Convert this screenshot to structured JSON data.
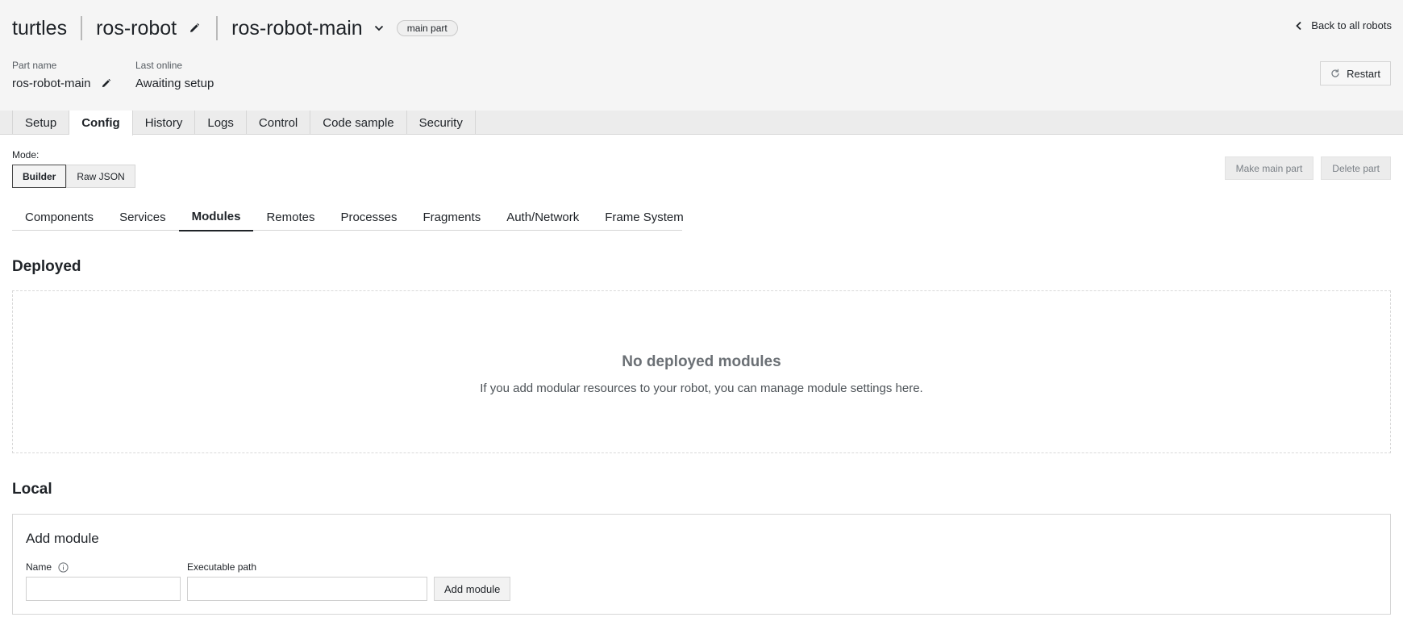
{
  "header": {
    "org": "turtles",
    "robot": "ros-robot",
    "part": "ros-robot-main",
    "badge": "main part",
    "back_label": "Back to all robots"
  },
  "meta": {
    "part_name_label": "Part name",
    "part_name_value": "ros-robot-main",
    "last_online_label": "Last online",
    "last_online_value": "Awaiting setup"
  },
  "restart_label": "Restart",
  "tabs": [
    {
      "label": "Setup"
    },
    {
      "label": "Config",
      "active": true
    },
    {
      "label": "History"
    },
    {
      "label": "Logs"
    },
    {
      "label": "Control"
    },
    {
      "label": "Code sample"
    },
    {
      "label": "Security"
    }
  ],
  "mode": {
    "label": "Mode:",
    "options": [
      "Builder",
      "Raw JSON"
    ],
    "selected": "Builder"
  },
  "part_actions": {
    "make_main": "Make main part",
    "delete": "Delete part"
  },
  "subtabs": [
    {
      "label": "Components"
    },
    {
      "label": "Services"
    },
    {
      "label": "Modules",
      "active": true
    },
    {
      "label": "Remotes"
    },
    {
      "label": "Processes"
    },
    {
      "label": "Fragments"
    },
    {
      "label": "Auth/Network"
    },
    {
      "label": "Frame System"
    }
  ],
  "deployed": {
    "title": "Deployed",
    "empty_title": "No deployed modules",
    "empty_text": "If you add modular resources to your robot, you can manage module settings here."
  },
  "local": {
    "title": "Local",
    "card_title": "Add module",
    "name_label": "Name",
    "name_value": "",
    "path_label": "Executable path",
    "path_value": "",
    "add_button": "Add module"
  },
  "icons": {
    "edit": "pencil-icon",
    "chevron": "chevron-down-icon",
    "back": "chevron-left-icon",
    "restart": "refresh-icon",
    "info": "info-icon"
  }
}
